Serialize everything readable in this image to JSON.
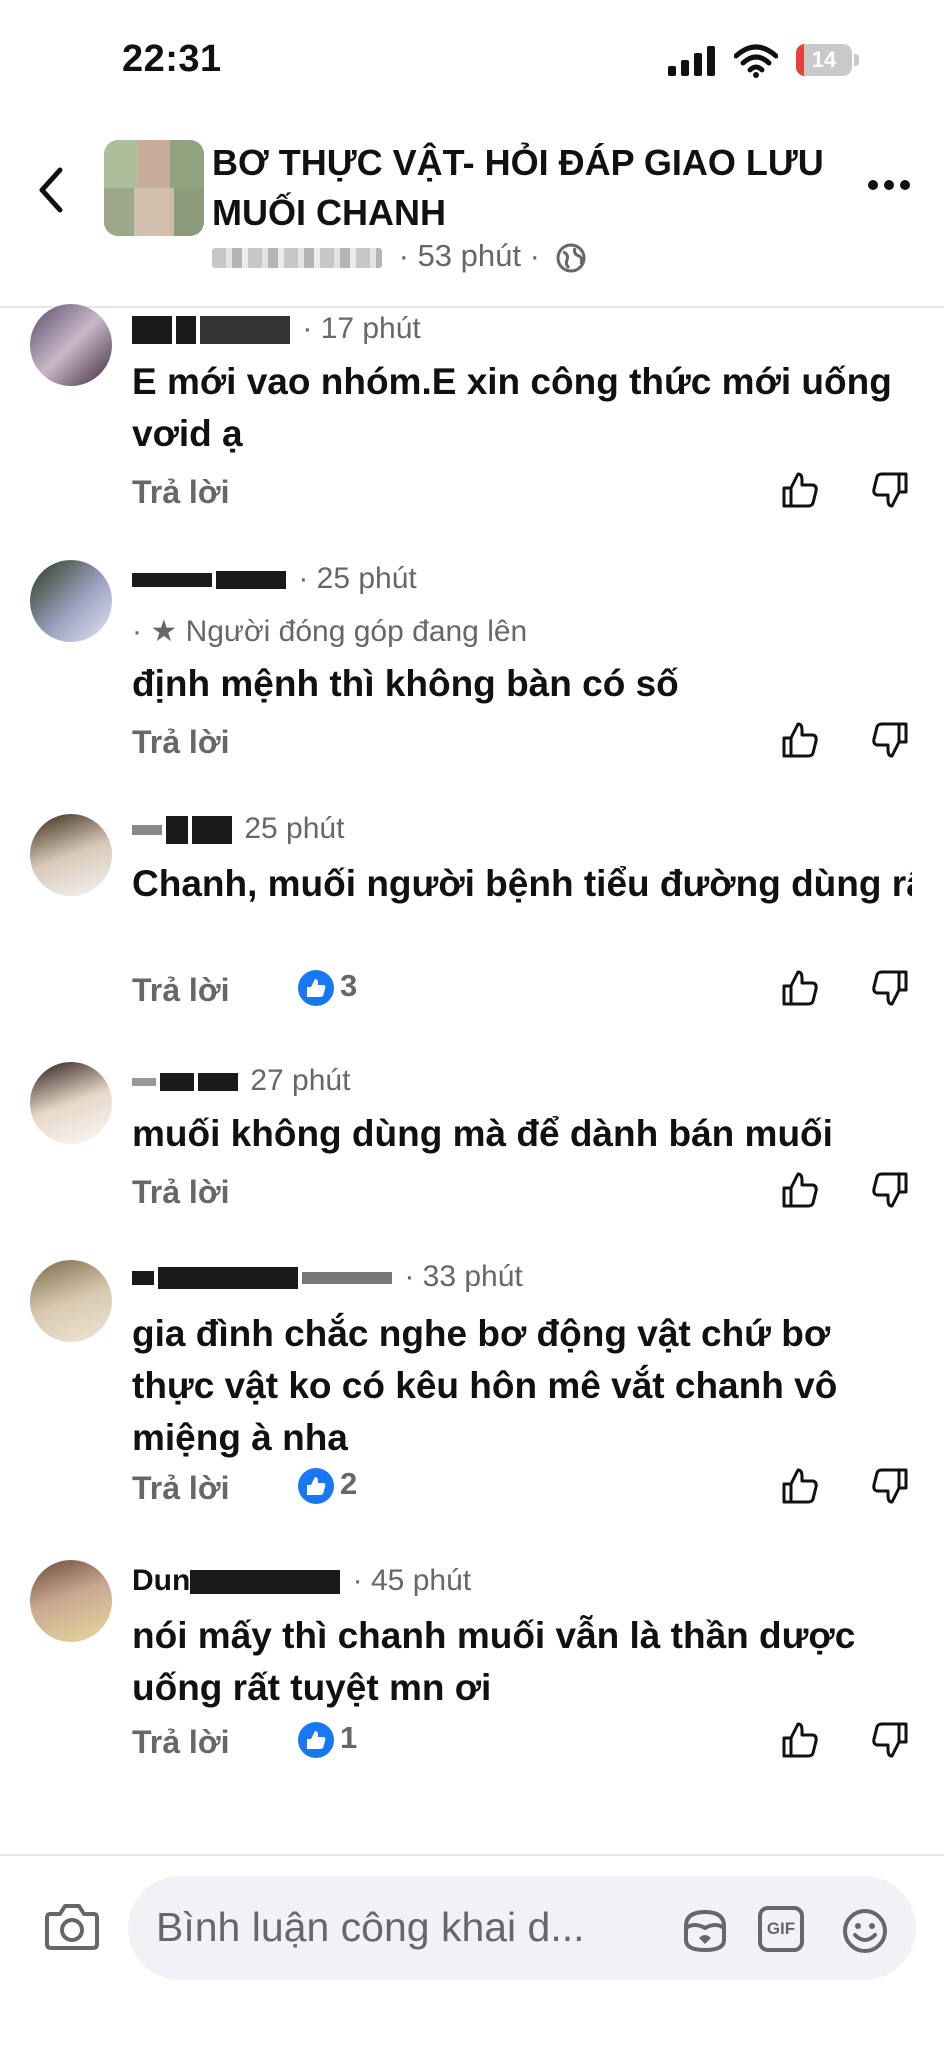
{
  "status_bar": {
    "time": "22:31",
    "battery": "14"
  },
  "header": {
    "title": "BƠ THỰC VẬT- HỎI ĐÁP GIAO LƯU MUỐI CHANH",
    "time_ago": "53 phút"
  },
  "comments": [
    {
      "time": "17 phút",
      "badge": "",
      "text": "E mới vao nhóm.E xin công thức mới uống vơid ạ",
      "reply_label": "Trả lời",
      "likes": ""
    },
    {
      "time": "25 phút",
      "badge": "Người đóng góp đang lên",
      "text": "định mệnh thì không bàn có số",
      "reply_label": "Trả lời",
      "likes": ""
    },
    {
      "time": "25 phút",
      "badge": "",
      "text": "Chanh, muối người bệnh tiểu đường dùng rất tốt cho sức khoẻ nha cả nhà...",
      "reply_label": "Trả lời",
      "likes": "3"
    },
    {
      "time": "27 phút",
      "badge": "",
      "text": "muối không dùng mà để dành bán muối",
      "reply_label": "Trả lời",
      "likes": ""
    },
    {
      "time": "33 phút",
      "badge": "",
      "text": "gia đình chắc nghe bơ động vật chứ bơ thực vật ko có kêu hôn mê vắt chanh vô miệng à nha",
      "reply_label": "Trả lời",
      "likes": "2"
    },
    {
      "time": "45 phút",
      "name_visible": "Dun",
      "badge": "",
      "text": "nói mấy thì chanh muối vẫn là thần dược uống rất tuyệt mn ơi",
      "reply_label": "Trả lời",
      "likes": "1"
    }
  ],
  "composer": {
    "placeholder": "Bình luận công khai d...",
    "gif_label": "GIF"
  },
  "colors": {
    "accent": "#1877f2",
    "battery_low": "#e8403b",
    "meta": "#65676b"
  },
  "icons": [
    "back-arrow-icon",
    "globe-icon",
    "more-icon",
    "thumbs-up-icon",
    "thumbs-down-icon",
    "like-reaction-icon",
    "camera-icon",
    "avatar-sticker-icon",
    "gif-icon",
    "emoji-icon"
  ]
}
